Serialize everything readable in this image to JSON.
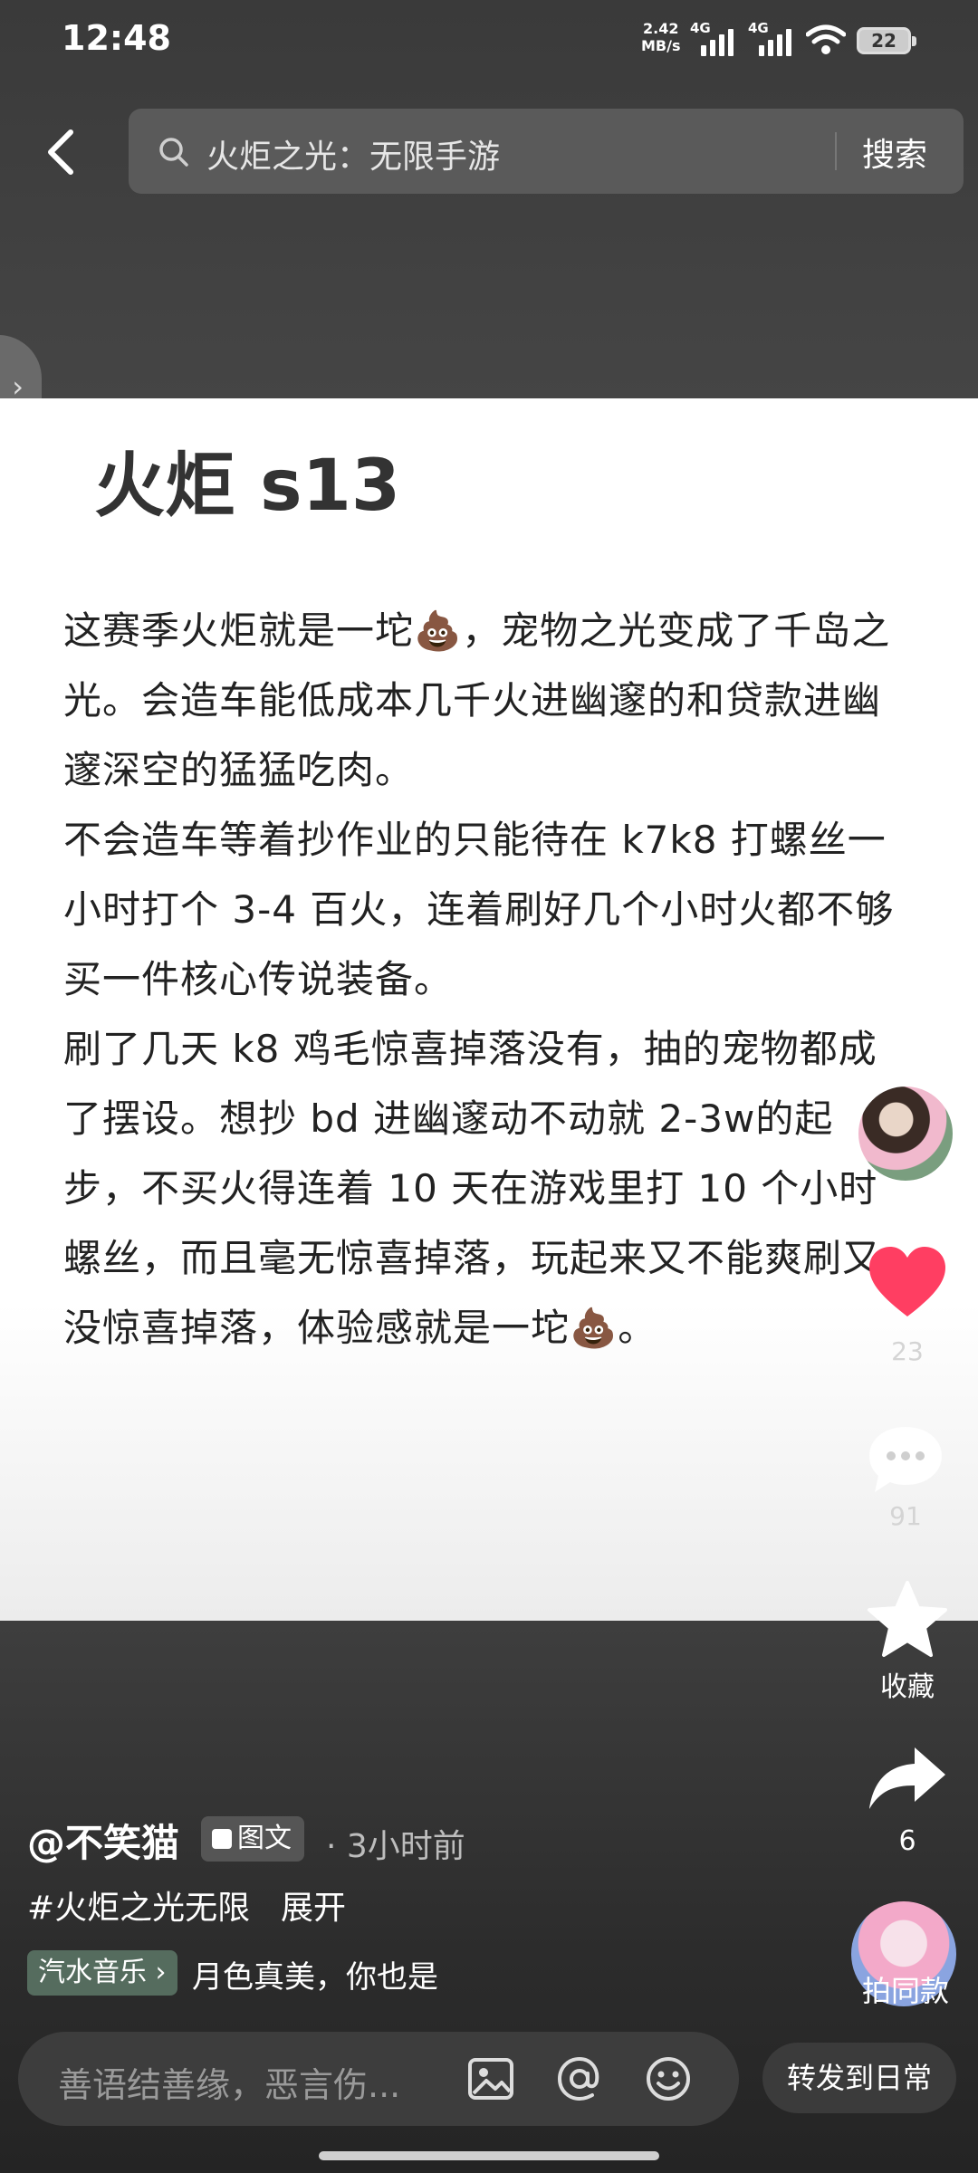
{
  "status_bar": {
    "time": "12:48",
    "net_speed_value": "2.42",
    "net_speed_unit": "MB/s",
    "signal_1": "4G",
    "signal_2": "4G",
    "battery": "22"
  },
  "search": {
    "query": "火炬之光：无限手游",
    "button": "搜索"
  },
  "side_tab_glyph": "›",
  "post": {
    "title": "火炬 s13",
    "paragraphs": [
      "这赛季火炬就是一坨💩，宠物之光变成了千岛之光。会造车能低成本几千火进幽邃的和贷款进幽邃深空的猛猛吃肉。",
      "不会造车等着抄作业的只能待在 k7k8 打螺丝一小时打个 3-4 百火，连着刷好几个小时火都不够买一件核心传说装备。",
      "刷了几天 k8 鸡毛惊喜掉落没有，抽的宠物都成了摆设。想抄 bd 进幽邃动不动就 2-3w的起步，不买火得连着 10 天在游戏里打 10 个小时螺丝，而且毫无惊喜掉落，玩起来又不能爽刷又没惊喜掉落，体验感就是一坨💩。"
    ]
  },
  "actions": {
    "likes": "23",
    "comments": "91",
    "favorite_label": "收藏",
    "shares": "6",
    "same_style_label": "拍同款"
  },
  "info": {
    "author": "@不笑猫",
    "type_badge": "图文",
    "posted": "· 3小时前",
    "hashtag": "#火炬之光无限",
    "expand": "展开",
    "music_badge": "汽水音乐 ›",
    "music_text": "月色真美，你也是"
  },
  "comment_bar": {
    "placeholder": "善语结善缘，恶言伤...",
    "forward": "转发到日常"
  },
  "colors": {
    "like": "#ff3e62",
    "card_bg": "#ffffff",
    "app_bg": "#2a2a2a"
  }
}
